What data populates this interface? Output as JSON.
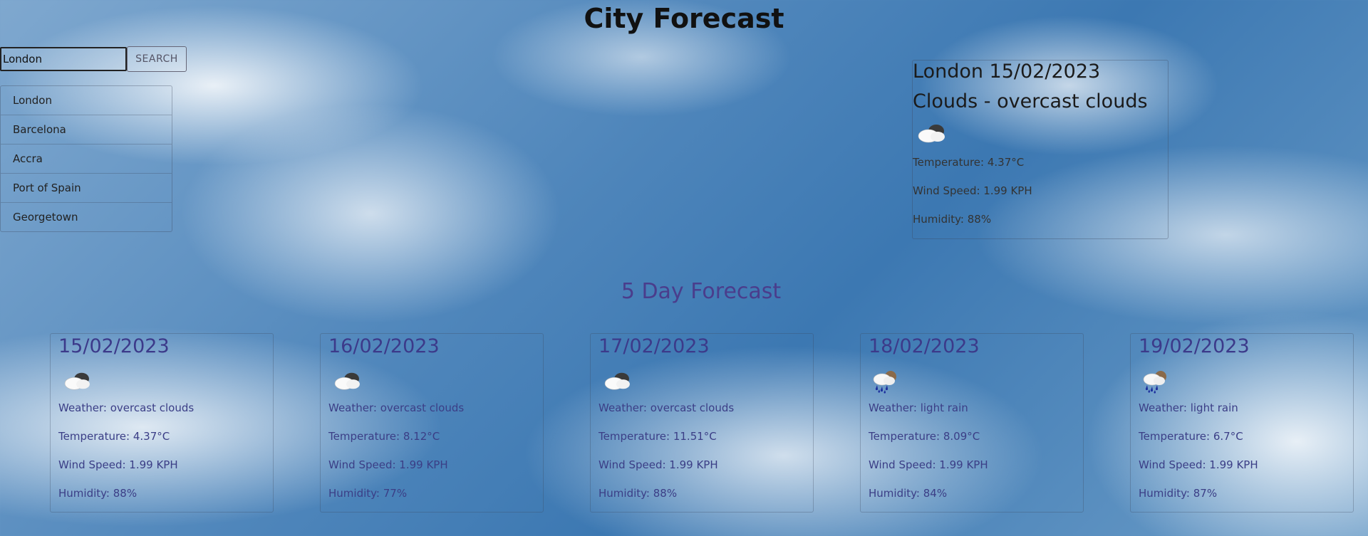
{
  "page_title": "City Forecast",
  "search": {
    "value": "London",
    "button_label": "SEARCH"
  },
  "history": [
    "London",
    "Barcelona",
    "Accra",
    "Port of Spain",
    "Georgetown"
  ],
  "current": {
    "city_date": "London 15/02/2023",
    "condition": "Clouds - overcast clouds",
    "icon": "overcast-clouds-icon",
    "temperature": "Temperature: 4.37°C",
    "wind": "Wind Speed: 1.99 KPH",
    "humidity": "Humidity: 88%"
  },
  "forecast_heading": "5 Day Forecast",
  "forecast": [
    {
      "date": "15/02/2023",
      "icon": "overcast-clouds-icon",
      "weather": "Weather: overcast clouds",
      "temperature": "Temperature: 4.37°C",
      "wind": "Wind Speed: 1.99 KPH",
      "humidity": "Humidity: 88%"
    },
    {
      "date": "16/02/2023",
      "icon": "overcast-clouds-icon",
      "weather": "Weather: overcast clouds",
      "temperature": "Temperature: 8.12°C",
      "wind": "Wind Speed: 1.99 KPH",
      "humidity": "Humidity: 77%"
    },
    {
      "date": "17/02/2023",
      "icon": "overcast-clouds-icon",
      "weather": "Weather: overcast clouds",
      "temperature": "Temperature: 11.51°C",
      "wind": "Wind Speed: 1.99 KPH",
      "humidity": "Humidity: 88%"
    },
    {
      "date": "18/02/2023",
      "icon": "light-rain-icon",
      "weather": "Weather: light rain",
      "temperature": "Temperature: 8.09°C",
      "wind": "Wind Speed: 1.99 KPH",
      "humidity": "Humidity: 84%"
    },
    {
      "date": "19/02/2023",
      "icon": "light-rain-icon",
      "weather": "Weather: light rain",
      "temperature": "Temperature: 6.7°C",
      "wind": "Wind Speed: 1.99 KPH",
      "humidity": "Humidity: 87%"
    }
  ]
}
